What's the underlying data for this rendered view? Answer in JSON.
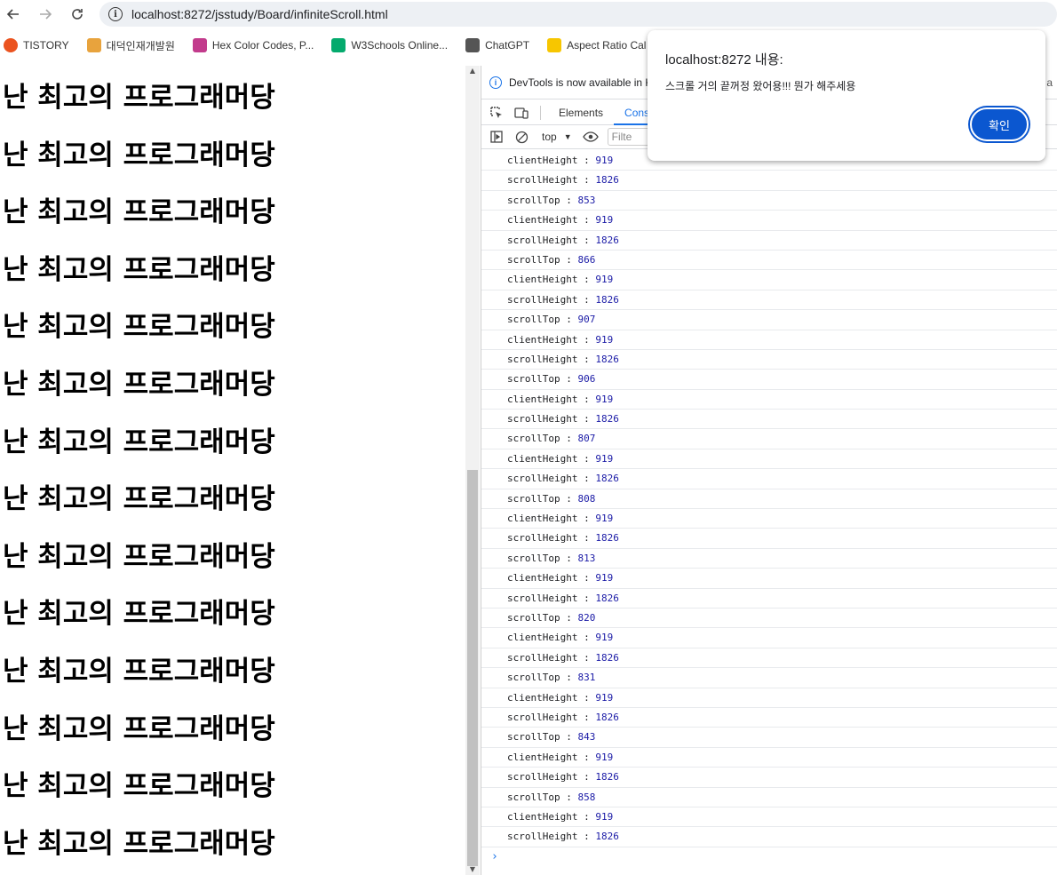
{
  "browser": {
    "url": "localhost:8272/jsstudy/Board/infiniteScroll.html",
    "bookmarks": [
      {
        "label": "TISTORY",
        "icon": "tistory-icon",
        "color": "#eb531f"
      },
      {
        "label": "대덕인재개발원",
        "icon": "logo-icon",
        "color": "#e8a33d"
      },
      {
        "label": "Hex Color Codes, P...",
        "icon": "color-bars-icon",
        "color": "#c23b8c"
      },
      {
        "label": "W3Schools Online...",
        "icon": "w3schools-icon",
        "color": "#04aa6d"
      },
      {
        "label": "ChatGPT",
        "icon": "chatgpt-icon",
        "color": "#555555"
      },
      {
        "label": "Aspect Ratio Cal",
        "icon": "aspect-icon",
        "color": "#f7c600"
      }
    ]
  },
  "page": {
    "heading": "난 최고의 프로그래머당",
    "heading_count": 14
  },
  "devtools": {
    "banner": "DevTools is now available in K",
    "banner_right": "w a",
    "tabs": [
      "Elements",
      "Conso"
    ],
    "active_tab": "Conso",
    "context": "top",
    "filter_placeholder": "Filte",
    "logs": [
      {
        "key": "clientHeight",
        "value": "919"
      },
      {
        "key": "scrollHeight",
        "value": "1826"
      },
      {
        "key": "scrollTop",
        "value": "853"
      },
      {
        "key": "clientHeight",
        "value": "919"
      },
      {
        "key": "scrollHeight",
        "value": "1826"
      },
      {
        "key": "scrollTop",
        "value": "866"
      },
      {
        "key": "clientHeight",
        "value": "919"
      },
      {
        "key": "scrollHeight",
        "value": "1826"
      },
      {
        "key": "scrollTop",
        "value": "907"
      },
      {
        "key": "clientHeight",
        "value": "919"
      },
      {
        "key": "scrollHeight",
        "value": "1826"
      },
      {
        "key": "scrollTop",
        "value": "906"
      },
      {
        "key": "clientHeight",
        "value": "919"
      },
      {
        "key": "scrollHeight",
        "value": "1826"
      },
      {
        "key": "scrollTop",
        "value": "807"
      },
      {
        "key": "clientHeight",
        "value": "919"
      },
      {
        "key": "scrollHeight",
        "value": "1826"
      },
      {
        "key": "scrollTop",
        "value": "808"
      },
      {
        "key": "clientHeight",
        "value": "919"
      },
      {
        "key": "scrollHeight",
        "value": "1826"
      },
      {
        "key": "scrollTop",
        "value": "813"
      },
      {
        "key": "clientHeight",
        "value": "919"
      },
      {
        "key": "scrollHeight",
        "value": "1826"
      },
      {
        "key": "scrollTop",
        "value": "820"
      },
      {
        "key": "clientHeight",
        "value": "919"
      },
      {
        "key": "scrollHeight",
        "value": "1826"
      },
      {
        "key": "scrollTop",
        "value": "831"
      },
      {
        "key": "clientHeight",
        "value": "919"
      },
      {
        "key": "scrollHeight",
        "value": "1826"
      },
      {
        "key": "scrollTop",
        "value": "843"
      },
      {
        "key": "clientHeight",
        "value": "919"
      },
      {
        "key": "scrollHeight",
        "value": "1826"
      },
      {
        "key": "scrollTop",
        "value": "858"
      },
      {
        "key": "clientHeight",
        "value": "919"
      },
      {
        "key": "scrollHeight",
        "value": "1826"
      }
    ],
    "prompt": "›"
  },
  "dialog": {
    "title": "localhost:8272 내용:",
    "message": "스크롤 거의 끝꺼정 왔어용!!! 뭔가 해주세용",
    "ok_label": "확인",
    "ok_color": "#0b57d0"
  }
}
